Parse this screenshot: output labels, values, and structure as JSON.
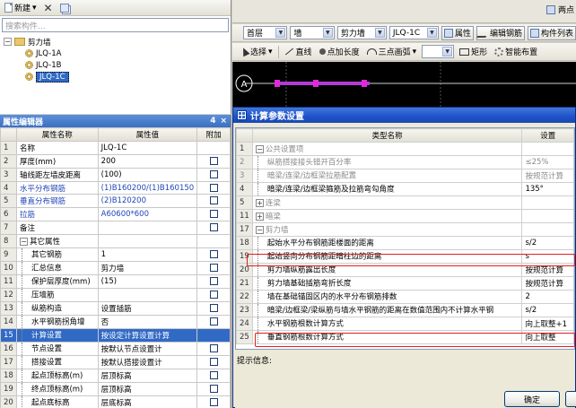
{
  "left_panel": {
    "toolbar": {
      "new_label": "新建",
      "new_arrow": "▾"
    },
    "search_placeholder": "搜索构件...",
    "tree": {
      "root": "剪力墙",
      "children": [
        "JLQ-1A",
        "JLQ-1B",
        "JLQ-1C"
      ],
      "selected_index": 2
    }
  },
  "property_editor": {
    "title": "属性编辑器",
    "title_controls": [
      "4",
      "×"
    ],
    "columns": [
      "属性名称",
      "属性值",
      "附加"
    ],
    "rows": [
      {
        "no": "1",
        "name": "名称",
        "value": "JLQ-1C",
        "blue": false,
        "check": false,
        "group": false,
        "indent": false
      },
      {
        "no": "2",
        "name": "厚度(mm)",
        "value": "200",
        "blue": false,
        "check": true,
        "group": false,
        "indent": false
      },
      {
        "no": "3",
        "name": "轴线距左墙皮距离",
        "value": "(100)",
        "blue": false,
        "check": true,
        "group": false,
        "indent": false
      },
      {
        "no": "4",
        "name": "水平分布钢筋",
        "value": "(1)B160200/(1)B160150",
        "blue": true,
        "check": true,
        "group": false,
        "indent": false
      },
      {
        "no": "5",
        "name": "垂直分布钢筋",
        "value": "(2)B120200",
        "blue": true,
        "check": true,
        "group": false,
        "indent": false
      },
      {
        "no": "6",
        "name": "拉筋",
        "value": "A60600*600",
        "blue": true,
        "check": true,
        "group": false,
        "indent": false
      },
      {
        "no": "7",
        "name": "备注",
        "value": "",
        "blue": false,
        "check": true,
        "group": false,
        "indent": false
      },
      {
        "no": "8",
        "name": "其它属性",
        "value": "",
        "blue": false,
        "check": false,
        "group": true,
        "indent": false
      },
      {
        "no": "9",
        "name": "其它钢筋",
        "value": "1",
        "blue": false,
        "check": true,
        "group": false,
        "indent": true
      },
      {
        "no": "10",
        "name": "汇总信息",
        "value": "剪力墙",
        "blue": false,
        "check": true,
        "group": false,
        "indent": true
      },
      {
        "no": "11",
        "name": "保护层厚度(mm)",
        "value": "(15)",
        "blue": false,
        "check": true,
        "group": false,
        "indent": true
      },
      {
        "no": "12",
        "name": "压墙筋",
        "value": "",
        "blue": false,
        "check": true,
        "group": false,
        "indent": true
      },
      {
        "no": "13",
        "name": "纵筋构造",
        "value": "设置插筋",
        "blue": false,
        "check": true,
        "group": false,
        "indent": true
      },
      {
        "no": "14",
        "name": "水平钢筋拐角增",
        "value": "否",
        "blue": false,
        "check": true,
        "group": false,
        "indent": true
      },
      {
        "no": "15",
        "name": "计算设置",
        "value": "按设定计算设置计算",
        "blue": false,
        "check": false,
        "group": false,
        "indent": true,
        "highlight": true
      },
      {
        "no": "16",
        "name": "节点设置",
        "value": "按默认节点设置计",
        "blue": false,
        "check": true,
        "group": false,
        "indent": true
      },
      {
        "no": "17",
        "name": "搭接设置",
        "value": "按默认搭接设置计",
        "blue": false,
        "check": true,
        "group": false,
        "indent": true
      },
      {
        "no": "18",
        "name": "起点顶标高(m)",
        "value": "层顶标高",
        "blue": false,
        "check": true,
        "group": false,
        "indent": true
      },
      {
        "no": "19",
        "name": "终点顶标高(m)",
        "value": "层顶标高",
        "blue": false,
        "check": true,
        "group": false,
        "indent": true
      },
      {
        "no": "20",
        "name": "起点底标高",
        "value": "层底标高",
        "blue": false,
        "check": true,
        "group": false,
        "indent": true
      }
    ]
  },
  "top_right": {
    "tab_label": "两点",
    "row1": {
      "floor": "首层",
      "type": "墙",
      "category": "剪力墙",
      "element": "JLQ-1C",
      "btn_properties": "属性",
      "btn_edit_rebar": "编辑钢筋",
      "btn_component_list": "构件列表"
    },
    "row2": {
      "select": "选择",
      "line": "直线",
      "point_length": "点加长度",
      "three_point_arc": "三点画弧",
      "rect": "矩形",
      "smart_place": "智能布置"
    }
  },
  "canvas": {
    "axis_label": "A"
  },
  "dialog": {
    "title": "计算参数设置",
    "columns": [
      "类型名称",
      "设置"
    ],
    "rows": [
      {
        "no": "1",
        "name": "公共设置项",
        "value": "",
        "kind": "group-open"
      },
      {
        "no": "2",
        "name": "纵筋搭接接头错开百分率",
        "value": "≤25%",
        "kind": "grey"
      },
      {
        "no": "3",
        "name": "暗梁/连梁/边框梁拉筋配置",
        "value": "按规范计算",
        "kind": "grey"
      },
      {
        "no": "4",
        "name": "暗梁/连梁/边框梁箍筋及拉筋弯勾角度",
        "value": "135°",
        "kind": "normal"
      },
      {
        "no": "5",
        "name": "连梁",
        "value": "",
        "kind": "group-closed"
      },
      {
        "no": "11",
        "name": "暗梁",
        "value": "",
        "kind": "group-closed"
      },
      {
        "no": "17",
        "name": "剪力墙",
        "value": "",
        "kind": "group-open"
      },
      {
        "no": "18",
        "name": "起始水平分布钢筋距楼面的距离",
        "value": "s/2",
        "kind": "normal"
      },
      {
        "no": "19",
        "name": "起始竖向分布钢筋距暗柱边的距离",
        "value": "s",
        "kind": "normal"
      },
      {
        "no": "20",
        "name": "剪力墙纵筋露出长度",
        "value": "按规范计算",
        "kind": "normal"
      },
      {
        "no": "21",
        "name": "剪力墙基础插筋弯折长度",
        "value": "按规范计算",
        "kind": "normal"
      },
      {
        "no": "22",
        "name": "墙在基础锚固区内的水平分布钢筋排数",
        "value": "2",
        "kind": "normal"
      },
      {
        "no": "23",
        "name": "暗梁/边框梁/梁纵筋与墙水平钢筋的距离在数值范围内不计算水平钢",
        "value": "s/2",
        "kind": "normal"
      },
      {
        "no": "24",
        "name": "水平钢筋根数计算方式",
        "value": "向上取整+1",
        "kind": "normal"
      },
      {
        "no": "25",
        "name": "垂直钢筋根数计算方式",
        "value": "向上取整",
        "kind": "normal"
      }
    ],
    "hint_label": "提示信息:",
    "ok_button": "确定"
  }
}
